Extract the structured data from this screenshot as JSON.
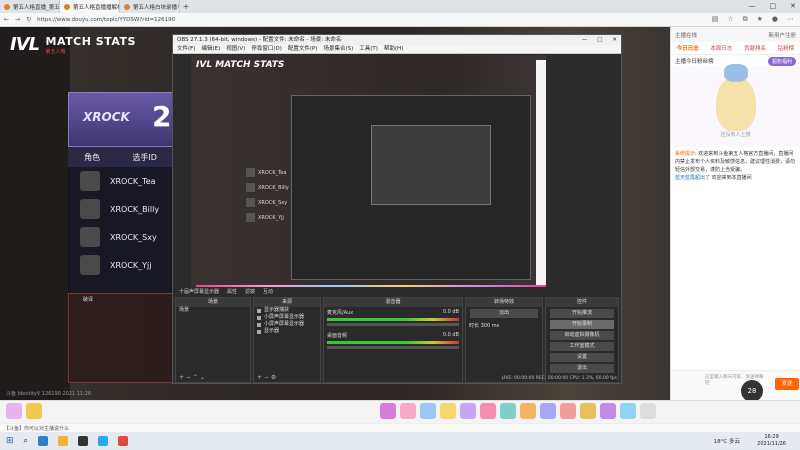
{
  "browser": {
    "tabs": [
      {
        "label": "第五人格直播_第五人格视频..."
      },
      {
        "label": "第五人格直播播解析...",
        "active": true
      },
      {
        "label": "第五人格白块录播"
      }
    ],
    "url": "https://www.douyu.com/topic/YYDSW?rid=126190",
    "window_controls": [
      "—",
      "□",
      "✕"
    ]
  },
  "stream": {
    "logo_mark": "IVL",
    "logo_title": "MATCH STATS",
    "logo_sub": "第五人格",
    "team_name": "XROCK",
    "score": "2",
    "roster_header": {
      "role": "角色",
      "player": "选手ID"
    },
    "players": [
      "XROCK_Tea",
      "XROCK_Billy",
      "XROCK_Sxy",
      "XROCK_Yjj"
    ],
    "offscreen_label": "破译",
    "footer": "斗鱼 IdentityV  126190   2021 11:26"
  },
  "obs": {
    "title": "OBS 27.1.3 (64-bit, windows) - 配置文件: 未命名 - 场景: 未命名",
    "menu": [
      "文件(F)",
      "编辑(E)",
      "视图(V)",
      "停靠窗口(D)",
      "配置文件(P)",
      "场景集合(S)",
      "工具(T)",
      "帮助(H)"
    ],
    "toolbar": [
      "十届声屏幕显示器",
      "属性",
      "滤镜",
      "互动"
    ],
    "docks": {
      "scenes": {
        "title": "场景",
        "items": [
          "场景"
        ]
      },
      "sources": {
        "title": "来源",
        "items": [
          "显示器捕获",
          "小屏声屏幕显示器",
          "小屏声屏幕显示器",
          "显示器"
        ]
      },
      "mixer": {
        "title": "混音器",
        "channels": [
          "麦克风/Aux",
          "桌面音频"
        ],
        "levels": [
          "0.0 dB",
          "0.0 dB"
        ]
      },
      "transitions": {
        "title": "转场特效",
        "type": "淡出",
        "duration_label": "时长",
        "duration": "300 ms"
      },
      "controls": {
        "title": "控件",
        "buttons": [
          "开始推流",
          "开始录制",
          "启动虚拟摄像机",
          "工作室模式",
          "设置",
          "退出"
        ]
      }
    },
    "status": "LIVE: 00:00:00   REC: 00:00:00   CPU: 1.3%, 60.00 fps"
  },
  "chat": {
    "top_left": "主播在线",
    "top_right": "新用户注册",
    "tabs": [
      "今日日志",
      "本周日志",
      "贡献排名",
      "钻粉榜"
    ],
    "rank_title": "主播今日粉丝榜",
    "rank_button": "超粉福利",
    "mascot_caption": "还没有人上榜",
    "messages": [
      {
        "prefix": "系统提示",
        "text": "欢迎来到斗鱼第五人格官方直播间，直播间内禁止发布个人资料及敏感信息，建议理性消费，请勿轻信外部交易，谨防上当受骗。"
      },
      {
        "prefix": "",
        "nick": "蓝天蓝霞超出了",
        "text": "欢迎来到本直播间"
      }
    ],
    "input_placeholder": "这里输入聊天内容，发送弹幕吧",
    "send_label": "发送",
    "level_badge": "28"
  },
  "giftbar": {
    "notice": "【斗鱼】你可以对主播说什么"
  },
  "taskbar": {
    "tray": "18°C 多云",
    "time": "16:29",
    "date": "2021/11/26"
  },
  "colors": {
    "accent": "#ff6600",
    "obs_bg": "#2b2b2b",
    "team_purple": "#6a5aa8"
  }
}
